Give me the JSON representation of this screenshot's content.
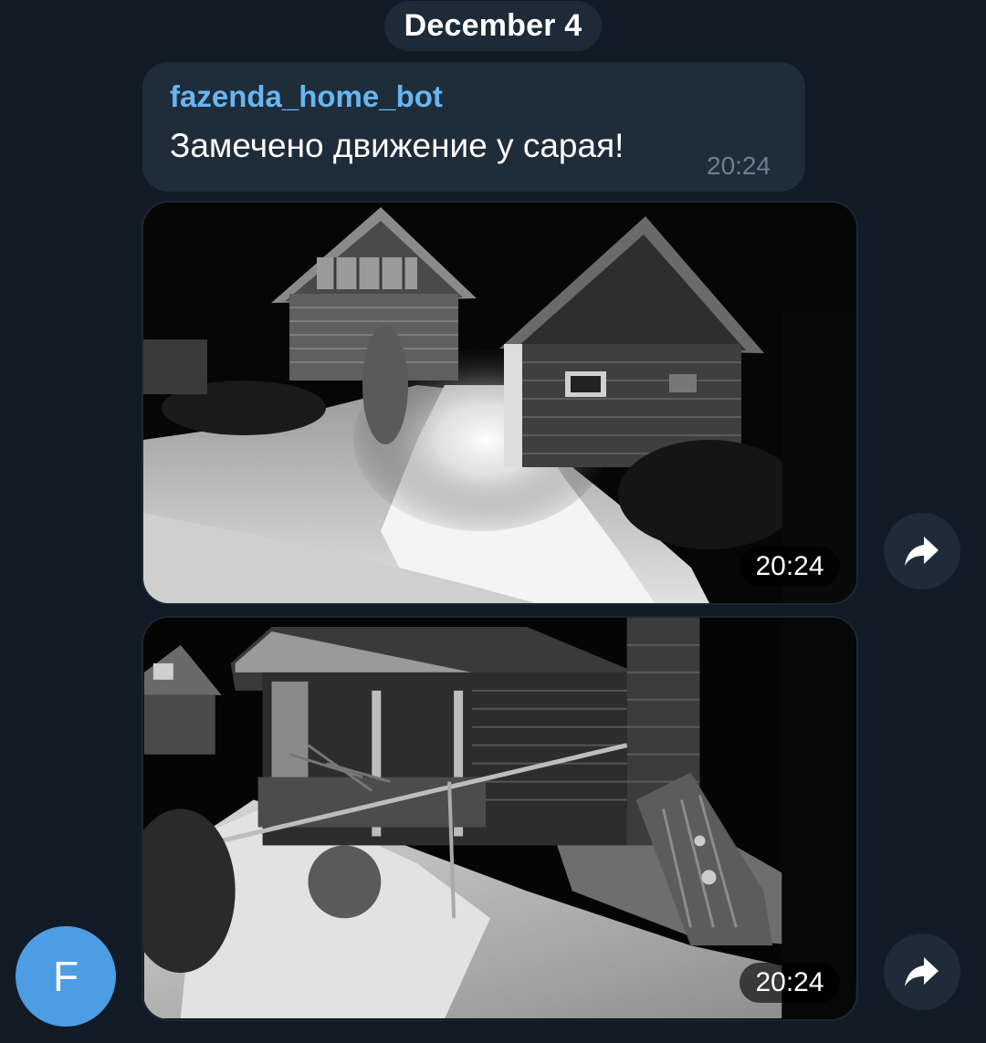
{
  "date_separator": "December 4",
  "message": {
    "sender": "fazenda_home_bot",
    "text": "Замечено движение у сарая!",
    "time": "20:24"
  },
  "photos": [
    {
      "time": "20:24",
      "share_icon": "share-arrow-icon"
    },
    {
      "time": "20:24",
      "share_icon": "share-arrow-icon"
    }
  ],
  "avatar": {
    "letter": "F",
    "color": "#4d9de4"
  },
  "colors": {
    "background": "#111b26",
    "bubble": "#1f2c3a",
    "sender_name": "#67b6f2",
    "time_muted": "#6f7f8f"
  }
}
